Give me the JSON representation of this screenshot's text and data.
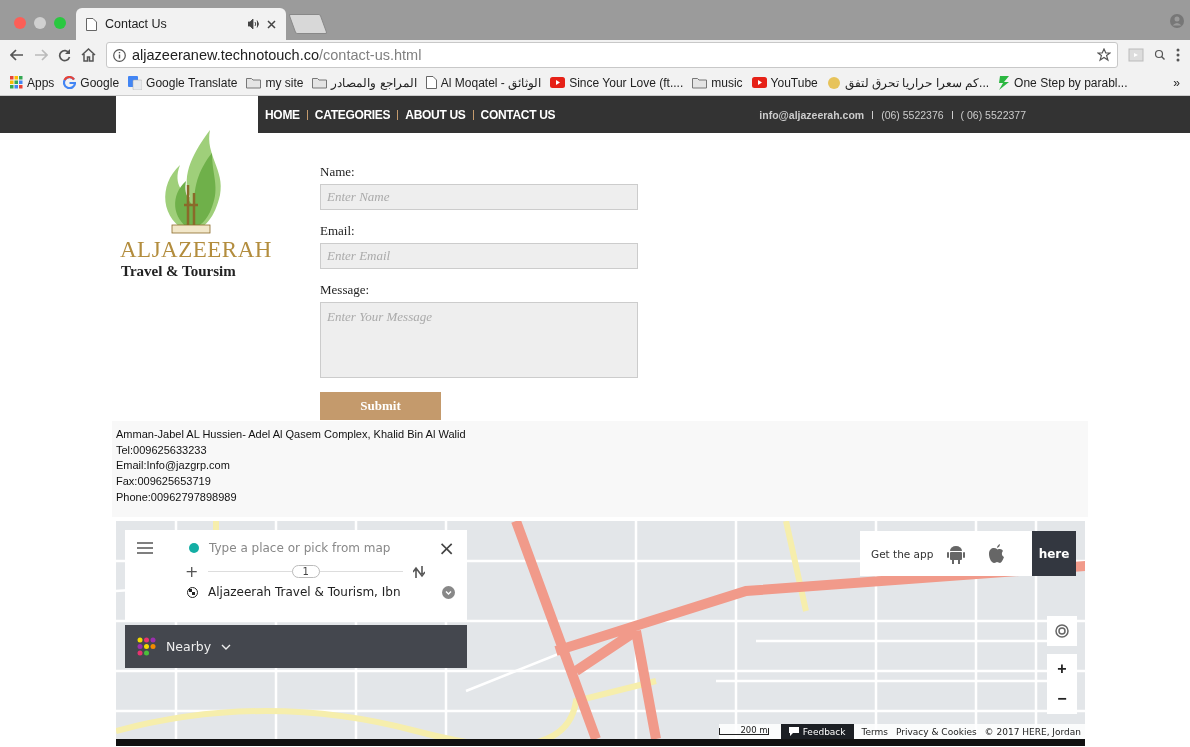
{
  "browser": {
    "tabs": [
      {
        "title": "Contact Us",
        "selected": true
      }
    ],
    "address": {
      "host": "aljazeeranew.technotouch.co",
      "path": "/contact-us.html"
    },
    "bookmarks": [
      {
        "kind": "apps",
        "label": "Apps"
      },
      {
        "kind": "google",
        "label": "Google"
      },
      {
        "kind": "translate",
        "label": "Google Translate"
      },
      {
        "kind": "folder",
        "label": "my site"
      },
      {
        "kind": "folder",
        "label": "المراجع والمصادر"
      },
      {
        "kind": "page",
        "label": "Al Moqatel - الوثائق"
      },
      {
        "kind": "video",
        "label": "Since Your Love (ft...."
      },
      {
        "kind": "folder",
        "label": "music"
      },
      {
        "kind": "video",
        "label": "YouTube"
      },
      {
        "kind": "site",
        "label": "كم سعرا حراريا تحرق لتفق..."
      },
      {
        "kind": "step",
        "label": "One Step by parabl..."
      }
    ],
    "more": "»"
  },
  "nav": {
    "items": [
      "HOME",
      "CATEGORIES",
      "ABOUT US",
      "CONTACT US"
    ],
    "email": "info@aljazeerah.com",
    "phones": [
      "(06) 5522376",
      "( 06) 5522377"
    ]
  },
  "logo": {
    "name": "ALJAZEERAH",
    "tagline": "Travel & Toursim"
  },
  "form": {
    "fields": [
      {
        "kind": "input",
        "label": "Name:",
        "placeholder": "Enter Name"
      },
      {
        "kind": "input",
        "label": "Email:",
        "placeholder": "Enter Email"
      },
      {
        "kind": "textarea",
        "label": "Message:",
        "placeholder": "Enter Your Message"
      }
    ],
    "submit": "Submit"
  },
  "address_lines": [
    "Amman-Jabel AL Hussien- Adel Al Qasem Complex, Khalid Bin Al Walid",
    "Tel:009625633233",
    "Email:Info@jazgrp.com",
    "Fax:009625653719",
    "Phone:00962797898989"
  ],
  "map": {
    "search_placeholder": "Type a place or pick from map",
    "close": "×",
    "add": "+",
    "step": "1",
    "destination": "Aljazeerah Travel & Tourism, Ibn",
    "nearby": "Nearby",
    "get_app": "Get the app",
    "brand": "here",
    "zoom_in": "+",
    "zoom_out": "−",
    "scale": "200 m",
    "feedback": "Feedback",
    "links": [
      "Terms",
      "Privacy & Cookies",
      "© 2017 HERE, Jordan"
    ]
  }
}
